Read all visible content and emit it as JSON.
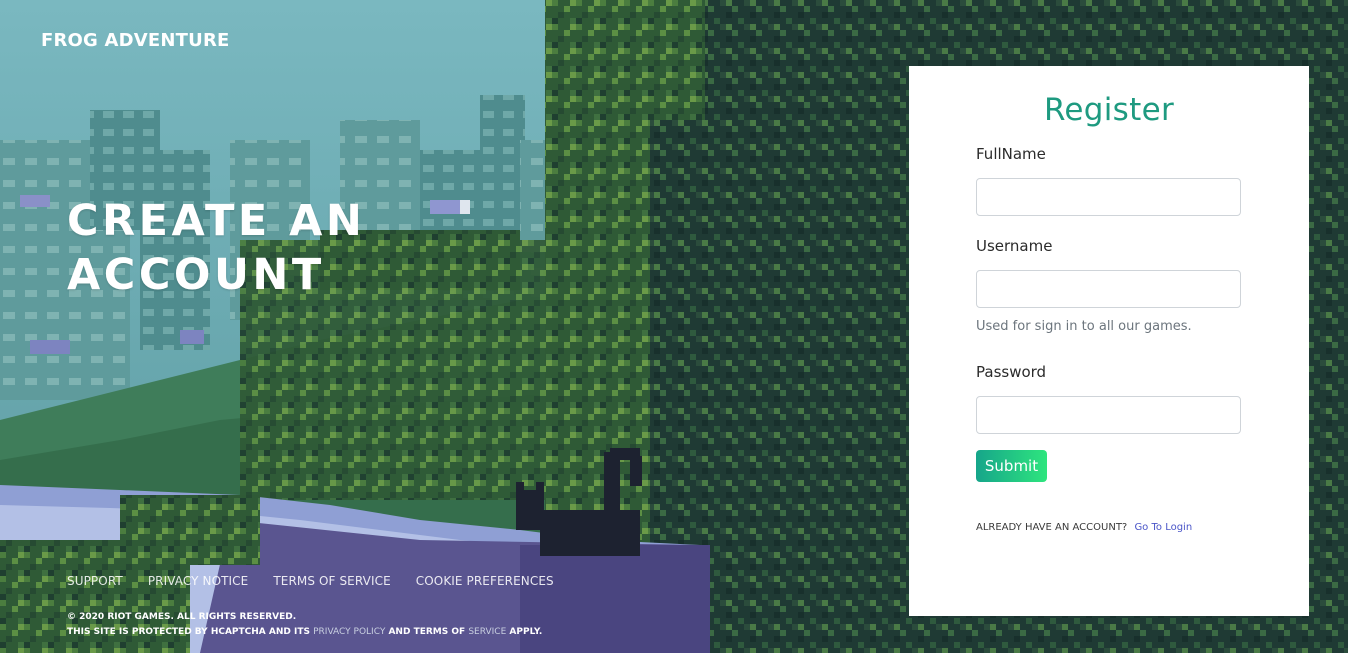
{
  "brand": {
    "name": "FROG ADVENTURE"
  },
  "hero": {
    "line1": "CREATE AN",
    "line2": "ACCOUNT"
  },
  "register": {
    "title": "Register",
    "fullname_label": "FullName",
    "fullname_value": "",
    "username_label": "Username",
    "username_value": "",
    "username_help": "Used for sign in to all our games.",
    "password_label": "Password",
    "password_value": "",
    "submit_label": "Submit",
    "login_prompt": "ALREADY HAVE AN ACCOUNT?",
    "login_link": "Go To Login"
  },
  "footer": {
    "links": [
      "SUPPORT",
      "PRIVACY NOTICE",
      "TERMS OF SERVICE",
      "COOKIE PREFERENCES"
    ],
    "copyright": "© 2020 RIOT GAMES. ALL RIGHTS RESERVED.",
    "hcaptcha_prefix": "THIS SITE IS PROTECTED BY HCAPTCHA AND ITS",
    "privacy_policy": "PRIVACY POLICY",
    "and_terms": "AND TERMS OF",
    "service": "SERVICE",
    "apply": "APPLY."
  },
  "colors": {
    "accent": "#1e9a80",
    "submit_gradient_start": "#16a58a",
    "submit_gradient_end": "#2ee57e",
    "link": "#4a55c8"
  },
  "icons": {
    "background": "pixel-art-city-forest-cat-illustration"
  }
}
